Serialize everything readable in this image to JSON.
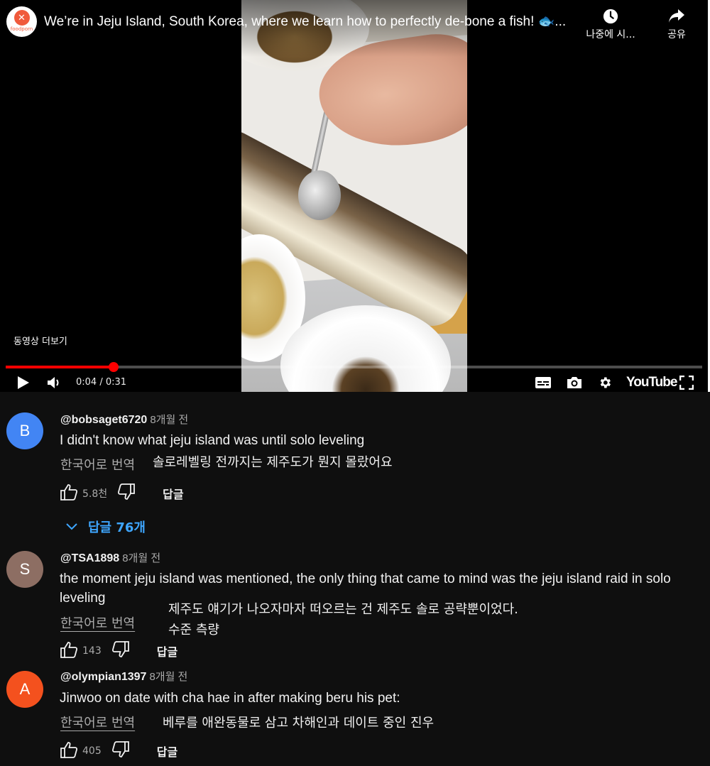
{
  "player": {
    "channel_logo_text": "foodporn",
    "title": "We’re in Jeju Island, South Korea, where we learn how to perfectly de-bone a fish! 🐟...",
    "watch_later_label": "나중에 시...",
    "share_label": "공유",
    "more_videos_label": "동영상 더보기",
    "time_display": "0:04 / 0:31",
    "progress_fraction": 0.1545,
    "youtube_label": "YouTube",
    "accent_color": "#ff0000"
  },
  "comments": [
    {
      "avatar_letter": "B",
      "avatar_color": "#4285f4",
      "author": "@bobsaget6720",
      "age": "8개월 전",
      "text": "I didn't know what jeju island was until solo leveling",
      "translate_label": "한국어로 번역",
      "translation": "솔로레벨링 전까지는 제주도가 뭔지 몰랐어요",
      "likes": "5.8천",
      "reply_label": "답글",
      "replies_label": "답글 76개"
    },
    {
      "avatar_letter": "S",
      "avatar_color": "#8d6e63",
      "author": "@TSA1898",
      "age": "8개월 전",
      "text": "the moment jeju island was mentioned, the only thing that came to mind was the jeju island raid in solo leveling",
      "translate_label": "한국어로 번역",
      "translation": "제주도 얘기가 나오자마자 떠오르는 건 제주도 솔로 공략뿐이었다.\n수준 측량",
      "likes": "143",
      "reply_label": "답글"
    },
    {
      "avatar_letter": "A",
      "avatar_color": "#f4511e",
      "author": "@olympian1397",
      "age": "8개월 전",
      "text": "Jinwoo on date with cha hae in after making beru his pet:",
      "translate_label": "한국어로 번역",
      "translation": "베루를 애완동물로 삼고 차해인과 데이트 중인 진우",
      "likes": "405",
      "reply_label": "답글"
    }
  ]
}
